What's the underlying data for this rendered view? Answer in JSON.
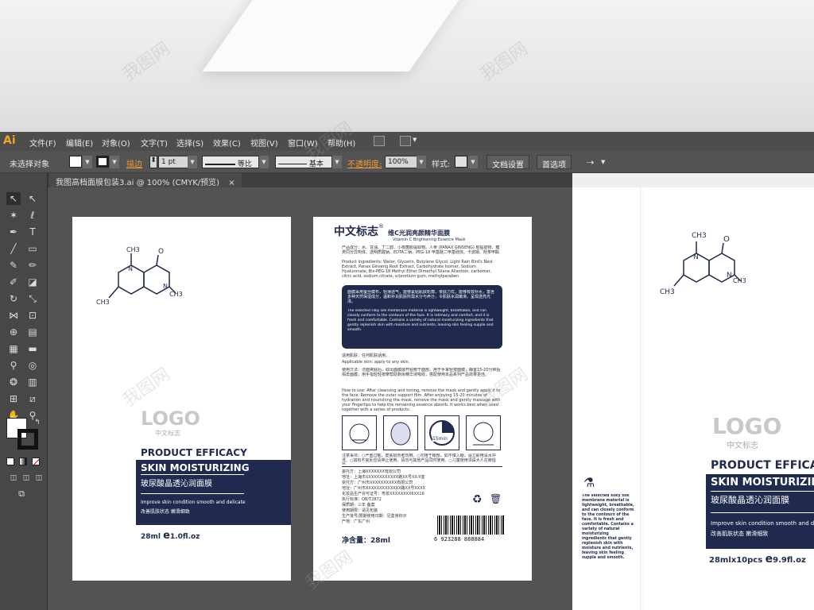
{
  "app": {
    "logo": "Ai"
  },
  "menu": [
    "文件(F)",
    "编辑(E)",
    "对象(O)",
    "文字(T)",
    "选择(S)",
    "效果(C)",
    "视图(V)",
    "窗口(W)",
    "帮助(H)"
  ],
  "control": {
    "selection": "未选择对象",
    "stroke_label": "描边",
    "stroke_weight": "1 pt",
    "profile": "等比",
    "brush": "基本",
    "opacity_label": "不透明度:",
    "opacity_value": "100%",
    "style_label": "样式:",
    "doc_setup": "文档设置",
    "preferences": "首选项"
  },
  "doc_tab": {
    "title": "我图高档面膜包装3.ai @ 100% (CMYK/预览)",
    "close": "×"
  },
  "colors": {
    "navy": "#1f2a4e",
    "accent": "#f29b35"
  },
  "front": {
    "logo": "LOGO",
    "logo_sub": "中文标志",
    "title1": "PRODUCT EFFICACY",
    "title2": "SKIN MOISTURIZING",
    "cn_title": "玻尿酸晶透沁润面膜",
    "desc_en": "Improve skin condition smooth and delicate",
    "desc_cn": "改善肌肤状态 嫩滑细致",
    "volume": "28ml",
    "e_mark": "e",
    "volume_oz": "1.0fl.oz",
    "mol_ch3_top": "CH3",
    "mol_ch3_left": "CH3",
    "mol_ch3_right": "CH3",
    "mol_n": "N",
    "mol_o": "O"
  },
  "back": {
    "brand": "中文标志",
    "reg": "®",
    "product_cn": "维C光润亮颜精华面膜",
    "product_en": "Vitamin C Brightening Essence Mask",
    "ingredients_cn": "产品成分：水、甘油、丁二醇、小核菌胶提取物、人参 (PANAX GINSENG) 根提取物、糖类同分异构体、透明质酸钠、EDTA二钠、PEG-18 甲基醚二甲基硅烷、卡波姆、羟苯甲酯",
    "ingredients_en": "Product Ingredients: Water, Glycerin, Butylene Glycol, Light Rain Bird's Nest Extract, Panax Ginseng Root Extract, Carbohydrate Isomer, Sodium Hyaluronate, Bis-PEG-18 Methyl Ether Dimethyl Silane Allantoin, carbomer, citric acid, sodium citrate, sclerotium gum, methylparaben",
    "box_cn": "面膜采用蚕丝膜布，轻薄透气，能够紧贴肌肤轮廓，亲肤力优，能够有效补水，富含多种天然保湿成分，温和补充肌肤所需水分与养分，令肌肤水润嫩滑，呈现透亮光泽。",
    "box_en": "The selected silky silk membrane material is lightweight, breathable, and can closely conform to the contours of the face. It is intimacy and comfort, and it is fresh and comfortable. Contains a variety of natural moisturizing ingredients that gently replenish skin with moisture and nutrients, leaving skin feeling supple and smooth.",
    "apply_cn": "适用肌肤：任何肌肤适用。",
    "apply_en": "Applicable skin: apply to any skin.",
    "usage_cn": "使用方法：洁面爽肤后，取出面膜展开贴敷于面部，用于手掌轻按面膜，静置15-20分钟后揭去面膜，用手指轻轻按摩帮助剩余精华液吸收，搭配使用本品系列产品效果更佳。",
    "usage_en": "How to use: After cleansing and toning, remove the mask and gently apply it to the face. Remove the outer support film. After enjoying 15-20 minutes of hydration and nourishing the mask, remove the mask and gently massage with your fingertips to help the remaining essence absorb. It works best when used together with a series of products.",
    "minutes": "15min",
    "notice": "注意事项：○严重过敏，皮肤损伤者勿用。○勿用于眼部，如不慎入眼，请立即用清水冲洗。○如有不良反应请停止使用，请勿与其他产品同时使用。○儿童使用须由大人在旁指导。",
    "maker1": "委托方：上海XXXXXXX有限公司",
    "maker2": "地址：上海市XXXXXXXXXXXX路XX号XX-X室",
    "maker3": "受托方：广州市XXXXXXXXXX有限公司",
    "maker4": "地址：广州市XXXXXXXXXXXXX路XX号XXXX",
    "maker5": "化妆品生产许可证号：粤妆XXXXXXXX6XX16",
    "maker6": "执行标准：QB/T2872",
    "maker7": "保质期：三年 备案",
    "maker8": "使用期限：请见包装",
    "maker9": "生产批号/限期使用日期：见盒身标示",
    "maker10": "产地：广东广州",
    "net": "净含量：28ml",
    "barcode": "6 923288 888884"
  },
  "preview": {
    "logo": "LOGO",
    "logo_sub": "中文标志",
    "title1": "PRODUCT EFFICA",
    "title2": "SKIN MOISTURIZIN",
    "cn_title": "玻尿酸晶透沁润面膜",
    "desc_en": "Improve skin condition smooth and delica",
    "desc_cn": "改善肌肤状态 嫩滑细致",
    "volume": "28mlx10pcs",
    "e_mark": "e",
    "volume_oz": "9.9fl.oz",
    "side_text": "The selected silky silk membrane material is lightweight, breathable, and can closely conform to the contours of the face. It is fresh and comfortable. Contains a variety of natural moisturizing ingredients that gently replenish skin with moisture and nutrients, leaving skin feeling supple and smooth.",
    "mol_ch3_top": "CH3",
    "mol_ch3_left": "CH3",
    "mol_ch3_right": "CH3",
    "mol_n": "N",
    "mol_o": "O"
  },
  "watermark": "我图网"
}
